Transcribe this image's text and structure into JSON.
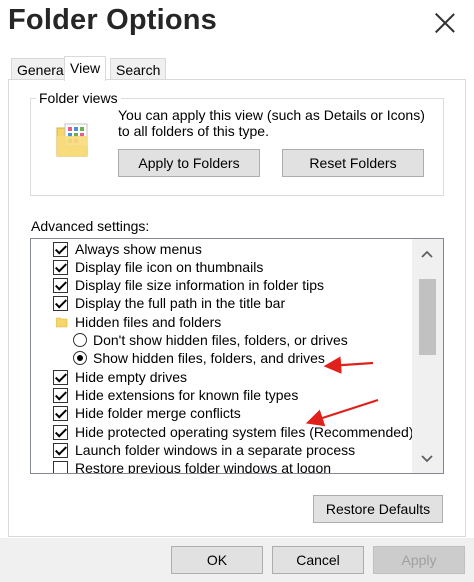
{
  "window": {
    "title": "Folder Options"
  },
  "tabs": [
    {
      "label": "General",
      "active": false
    },
    {
      "label": "View",
      "active": true
    },
    {
      "label": "Search",
      "active": false
    }
  ],
  "folder_views": {
    "label": "Folder views",
    "description": "You can apply this view (such as Details or Icons) to all folders of this type.",
    "apply_button": "Apply to Folders",
    "reset_button": "Reset Folders"
  },
  "advanced": {
    "label": "Advanced settings:",
    "items": [
      {
        "type": "checkbox",
        "checked": true,
        "label": "Always show menus"
      },
      {
        "type": "checkbox",
        "checked": true,
        "label": "Display file icon on thumbnails"
      },
      {
        "type": "checkbox",
        "checked": true,
        "label": "Display file size information in folder tips"
      },
      {
        "type": "checkbox",
        "checked": true,
        "label": "Display the full path in the title bar"
      },
      {
        "type": "folder",
        "label": "Hidden files and folders"
      },
      {
        "type": "radio",
        "selected": false,
        "label": "Don't show hidden files, folders, or drives"
      },
      {
        "type": "radio",
        "selected": true,
        "label": "Show hidden files, folders, and drives"
      },
      {
        "type": "checkbox",
        "checked": true,
        "label": "Hide empty drives"
      },
      {
        "type": "checkbox",
        "checked": true,
        "label": "Hide extensions for known file types"
      },
      {
        "type": "checkbox",
        "checked": true,
        "label": "Hide folder merge conflicts"
      },
      {
        "type": "checkbox",
        "checked": true,
        "label": "Hide protected operating system files (Recommended)"
      },
      {
        "type": "checkbox",
        "checked": true,
        "label": "Launch folder windows in a separate process"
      },
      {
        "type": "checkbox",
        "checked": false,
        "label": "Restore previous folder windows at logon"
      }
    ],
    "restore_defaults": "Restore Defaults"
  },
  "footer": {
    "ok": "OK",
    "cancel": "Cancel",
    "apply": "Apply"
  },
  "colors": {
    "annotation_arrow": "#e0201b",
    "folder_yellow": "#f6d56b"
  }
}
